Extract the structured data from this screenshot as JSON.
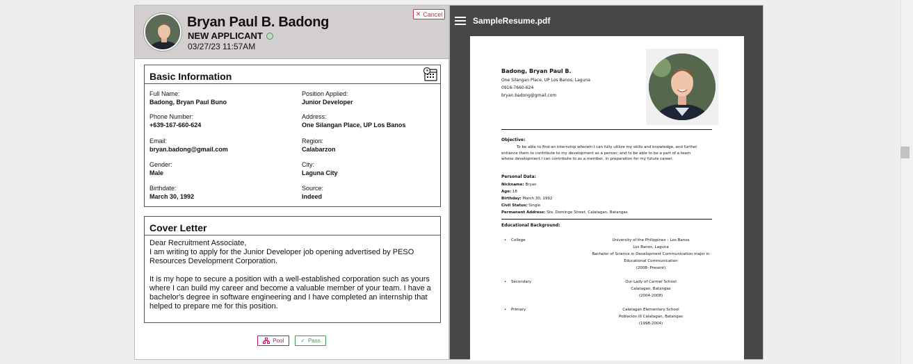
{
  "applicant": {
    "name": "Bryan Paul B. Badong",
    "status": "NEW APPLICANT",
    "timestamp": "03/27/23 11:57AM",
    "cancel_label": "Cancel"
  },
  "basic_info": {
    "title": "Basic Information",
    "fields": [
      {
        "label": "Full Name:",
        "value": "Badong, Bryan Paul Buno"
      },
      {
        "label": "Position Applied:",
        "value": "Junior Developer"
      },
      {
        "label": "Phone Number:",
        "value": "+639-167-660-624"
      },
      {
        "label": "Address:",
        "value": "One Silangan Place, UP Los Banos"
      },
      {
        "label": "Email:",
        "value": "bryan.badong@gmail.com"
      },
      {
        "label": "Region:",
        "value": "Calabarzon"
      },
      {
        "label": "Gender:",
        "value": "Male"
      },
      {
        "label": "City:",
        "value": "Laguna City"
      },
      {
        "label": "Birthdate:",
        "value": "March 30, 1992"
      },
      {
        "label": "Source:",
        "value": "Indeed"
      }
    ]
  },
  "cover_letter": {
    "title": "Cover Letter",
    "paragraphs": [
      "Dear Recruitment Associate,\nI am writing to apply for the Junior Developer job opening advertised by PESO Resources Development Corporation.",
      "It is my hope to secure a position with a well-established corporation such as yours where I can build my career and become a valuable member of your team. I have a bachelor's degree in software engineering and I have completed an internship that helped to prepare me for this position."
    ]
  },
  "actions": {
    "pool_label": "Pool",
    "pass_label": "Pass"
  },
  "viewer": {
    "file_name": "SampleResume.pdf",
    "resume": {
      "name": "Badong, Bryan Paul B.",
      "address": "One Silangan Place, UP Los Banos, Laguna",
      "phone": "0916-7660-624",
      "email": "bryan.badong@gmail.com",
      "objective_title": "Objective:",
      "objective_lines": [
        "To be able to find an internship wherein I can fully utilize my skills and knowledge, and further",
        "enhance them to contribute to my development as a person; and to be able to be a part of a team",
        "whose development I can contribute to as a member, in preparation for my future career."
      ],
      "personal_title": "Personal Data:",
      "personal": [
        {
          "k": "Nickname:",
          "v": "Bryan"
        },
        {
          "k": "Age:",
          "v": "18"
        },
        {
          "k": "Birthday:",
          "v": "March 30, 1992"
        },
        {
          "k": "Civil Status:",
          "v": "Single"
        },
        {
          "k": "Permanent Address:",
          "v": "Sto. Domingo Street, Calatagan, Batangas"
        }
      ],
      "education_title": "Educational Background:",
      "education": [
        {
          "level": "College",
          "lines": [
            "University of the Philippines – Los Banos",
            "Los Banos, Laguna",
            "Bachelor of Science in Development Communication major in",
            "Educational Communication",
            "(2008- Present)"
          ]
        },
        {
          "level": "Secondary",
          "lines": [
            "Our Lady of Carmel School",
            "Calatagan, Batangas",
            "(2004-2008)"
          ]
        },
        {
          "level": "Primary",
          "lines": [
            "Calatagan  Elementary School",
            "Poblacion III Calatagan, Batangas",
            "(1998-2004)"
          ]
        }
      ]
    }
  }
}
